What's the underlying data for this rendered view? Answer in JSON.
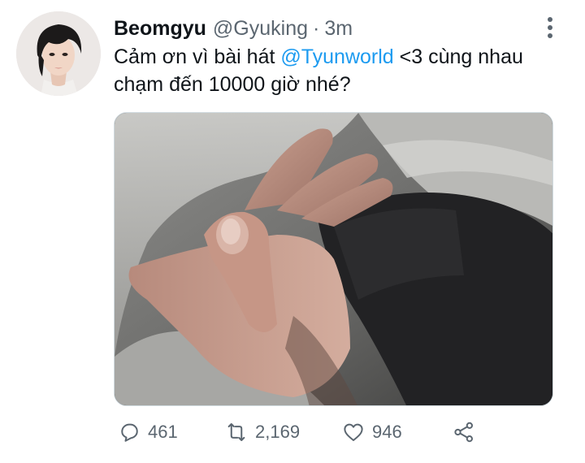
{
  "tweet": {
    "author": {
      "display_name": "Beomgyu",
      "handle": "@Gyuking",
      "separator": "·",
      "time": "3m"
    },
    "text": {
      "part1": "Cảm ơn vì bài hát ",
      "mention": "@Tyunworld",
      "part2": " <3 cùng nhau chạm đến 10000 giờ nhé?"
    },
    "media_alt": "photo",
    "actions": {
      "reply_count": "461",
      "retweet_count": "2,169",
      "like_count": "946"
    },
    "icons": {
      "reply": "reply-icon",
      "retweet": "retweet-icon",
      "like": "heart-icon",
      "share": "share-icon",
      "more": "more-vertical-icon"
    },
    "colors": {
      "mention": "#1d9bf0",
      "secondary_text": "#5b6670",
      "primary_text": "#0f1419"
    }
  }
}
